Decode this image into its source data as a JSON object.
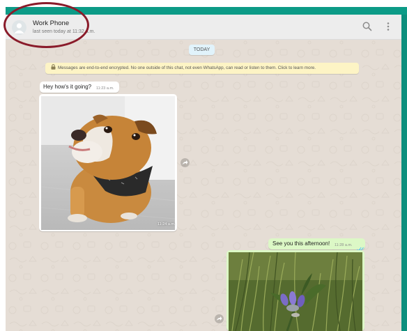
{
  "chat": {
    "contact_name": "Work Phone",
    "last_seen": "last seen today at 11:32 a.m."
  },
  "header_icons": [
    "search-icon",
    "menu-dots-icon"
  ],
  "date_label": "TODAY",
  "encryption_notice": "Messages are end-to-end encrypted. No one outside of this chat, not even WhatsApp, can read or listen to them. Click to learn more.",
  "messages": [
    {
      "type": "text",
      "direction": "incoming",
      "text": "Hey how's it going?",
      "time": "11:23 a.m."
    },
    {
      "type": "image",
      "direction": "incoming",
      "subject": "bulldog wearing a bandana",
      "time": "11:24 a.m."
    },
    {
      "type": "text",
      "direction": "outgoing",
      "text": "See you this afternoon!",
      "time": "11:28 a.m.",
      "status": "read"
    },
    {
      "type": "image",
      "direction": "outgoing",
      "subject": "purple wildflower in grass",
      "time": ""
    }
  ],
  "colors": {
    "teal_accent": "#0c9b87",
    "chat_background": "#e5ddd5",
    "outgoing_bubble": "#dcf8c6",
    "incoming_bubble": "#ffffff",
    "read_tick": "#4fc3f7",
    "annotation_circle": "#8a1b2a"
  }
}
